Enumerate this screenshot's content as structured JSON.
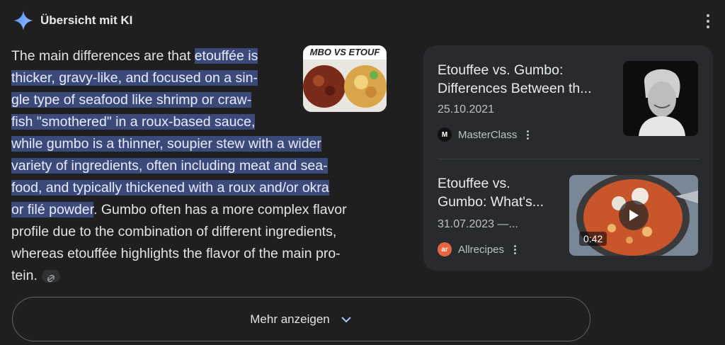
{
  "header": {
    "title": "Übersicht mit KI"
  },
  "answer": {
    "intro": "The main differences are that ",
    "highlight_1": "etouffée is",
    "highlight_2": "thicker, gravy-like, and focused on a sin-",
    "highlight_3": "gle type of seafood like shrimp or craw-",
    "highlight_4": "fish \"smothered\" in a roux-based sauce,",
    "highlight_5": "while gumbo is a thinner, soupier stew with a wider",
    "highlight_6": "variety of ingredients, often including meat and sea-",
    "highlight_7": "food, and typically thickened with a roux and/or okra",
    "highlight_8": "or filé powder",
    "rest_1": ". Gumbo often has a more complex flavor",
    "rest_2": "profile due to the combination of different ingredients,",
    "rest_3": "whereas etouffée highlights the flavor of the main pro-",
    "rest_4": "tein.",
    "thumb_text": "MBO VS ETOUF"
  },
  "sources": [
    {
      "title": "Etouffee vs. Gumbo: Differences Between th...",
      "date": "25.10.2021",
      "site": "MasterClass",
      "favicon": "M"
    },
    {
      "title": "Etouffee vs. Gumbo: What's...",
      "date": "31.07.2023 —...",
      "site": "Allrecipes",
      "favicon": "ar",
      "duration": "0:42"
    }
  ],
  "more_button": {
    "label": "Mehr anzeigen"
  },
  "colors": {
    "background": "#1f1f1f",
    "highlight": "#3c4a7a",
    "panel": "#282a2d",
    "accent": "#8ab4f8"
  },
  "icons": [
    "sparkle-icon",
    "more-vert-icon",
    "link-icon",
    "play-icon",
    "chevron-down-icon"
  ]
}
